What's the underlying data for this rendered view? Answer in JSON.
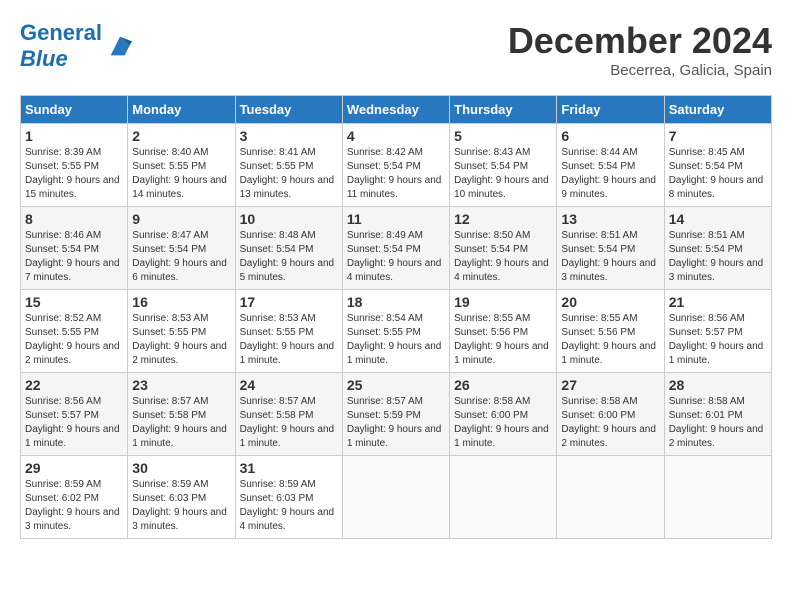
{
  "header": {
    "logo_general": "General",
    "logo_blue": "Blue",
    "month_year": "December 2024",
    "location": "Becerrea, Galicia, Spain"
  },
  "weekdays": [
    "Sunday",
    "Monday",
    "Tuesday",
    "Wednesday",
    "Thursday",
    "Friday",
    "Saturday"
  ],
  "weeks": [
    [
      {
        "day": "1",
        "sunrise": "8:39 AM",
        "sunset": "5:55 PM",
        "daylight": "9 hours and 15 minutes."
      },
      {
        "day": "2",
        "sunrise": "8:40 AM",
        "sunset": "5:55 PM",
        "daylight": "9 hours and 14 minutes."
      },
      {
        "day": "3",
        "sunrise": "8:41 AM",
        "sunset": "5:55 PM",
        "daylight": "9 hours and 13 minutes."
      },
      {
        "day": "4",
        "sunrise": "8:42 AM",
        "sunset": "5:54 PM",
        "daylight": "9 hours and 11 minutes."
      },
      {
        "day": "5",
        "sunrise": "8:43 AM",
        "sunset": "5:54 PM",
        "daylight": "9 hours and 10 minutes."
      },
      {
        "day": "6",
        "sunrise": "8:44 AM",
        "sunset": "5:54 PM",
        "daylight": "9 hours and 9 minutes."
      },
      {
        "day": "7",
        "sunrise": "8:45 AM",
        "sunset": "5:54 PM",
        "daylight": "9 hours and 8 minutes."
      }
    ],
    [
      {
        "day": "8",
        "sunrise": "8:46 AM",
        "sunset": "5:54 PM",
        "daylight": "9 hours and 7 minutes."
      },
      {
        "day": "9",
        "sunrise": "8:47 AM",
        "sunset": "5:54 PM",
        "daylight": "9 hours and 6 minutes."
      },
      {
        "day": "10",
        "sunrise": "8:48 AM",
        "sunset": "5:54 PM",
        "daylight": "9 hours and 5 minutes."
      },
      {
        "day": "11",
        "sunrise": "8:49 AM",
        "sunset": "5:54 PM",
        "daylight": "9 hours and 4 minutes."
      },
      {
        "day": "12",
        "sunrise": "8:50 AM",
        "sunset": "5:54 PM",
        "daylight": "9 hours and 4 minutes."
      },
      {
        "day": "13",
        "sunrise": "8:51 AM",
        "sunset": "5:54 PM",
        "daylight": "9 hours and 3 minutes."
      },
      {
        "day": "14",
        "sunrise": "8:51 AM",
        "sunset": "5:54 PM",
        "daylight": "9 hours and 3 minutes."
      }
    ],
    [
      {
        "day": "15",
        "sunrise": "8:52 AM",
        "sunset": "5:55 PM",
        "daylight": "9 hours and 2 minutes."
      },
      {
        "day": "16",
        "sunrise": "8:53 AM",
        "sunset": "5:55 PM",
        "daylight": "9 hours and 2 minutes."
      },
      {
        "day": "17",
        "sunrise": "8:53 AM",
        "sunset": "5:55 PM",
        "daylight": "9 hours and 1 minute."
      },
      {
        "day": "18",
        "sunrise": "8:54 AM",
        "sunset": "5:55 PM",
        "daylight": "9 hours and 1 minute."
      },
      {
        "day": "19",
        "sunrise": "8:55 AM",
        "sunset": "5:56 PM",
        "daylight": "9 hours and 1 minute."
      },
      {
        "day": "20",
        "sunrise": "8:55 AM",
        "sunset": "5:56 PM",
        "daylight": "9 hours and 1 minute."
      },
      {
        "day": "21",
        "sunrise": "8:56 AM",
        "sunset": "5:57 PM",
        "daylight": "9 hours and 1 minute."
      }
    ],
    [
      {
        "day": "22",
        "sunrise": "8:56 AM",
        "sunset": "5:57 PM",
        "daylight": "9 hours and 1 minute."
      },
      {
        "day": "23",
        "sunrise": "8:57 AM",
        "sunset": "5:58 PM",
        "daylight": "9 hours and 1 minute."
      },
      {
        "day": "24",
        "sunrise": "8:57 AM",
        "sunset": "5:58 PM",
        "daylight": "9 hours and 1 minute."
      },
      {
        "day": "25",
        "sunrise": "8:57 AM",
        "sunset": "5:59 PM",
        "daylight": "9 hours and 1 minute."
      },
      {
        "day": "26",
        "sunrise": "8:58 AM",
        "sunset": "6:00 PM",
        "daylight": "9 hours and 1 minute."
      },
      {
        "day": "27",
        "sunrise": "8:58 AM",
        "sunset": "6:00 PM",
        "daylight": "9 hours and 2 minutes."
      },
      {
        "day": "28",
        "sunrise": "8:58 AM",
        "sunset": "6:01 PM",
        "daylight": "9 hours and 2 minutes."
      }
    ],
    [
      {
        "day": "29",
        "sunrise": "8:59 AM",
        "sunset": "6:02 PM",
        "daylight": "9 hours and 3 minutes."
      },
      {
        "day": "30",
        "sunrise": "8:59 AM",
        "sunset": "6:03 PM",
        "daylight": "9 hours and 3 minutes."
      },
      {
        "day": "31",
        "sunrise": "8:59 AM",
        "sunset": "6:03 PM",
        "daylight": "9 hours and 4 minutes."
      },
      null,
      null,
      null,
      null
    ]
  ]
}
